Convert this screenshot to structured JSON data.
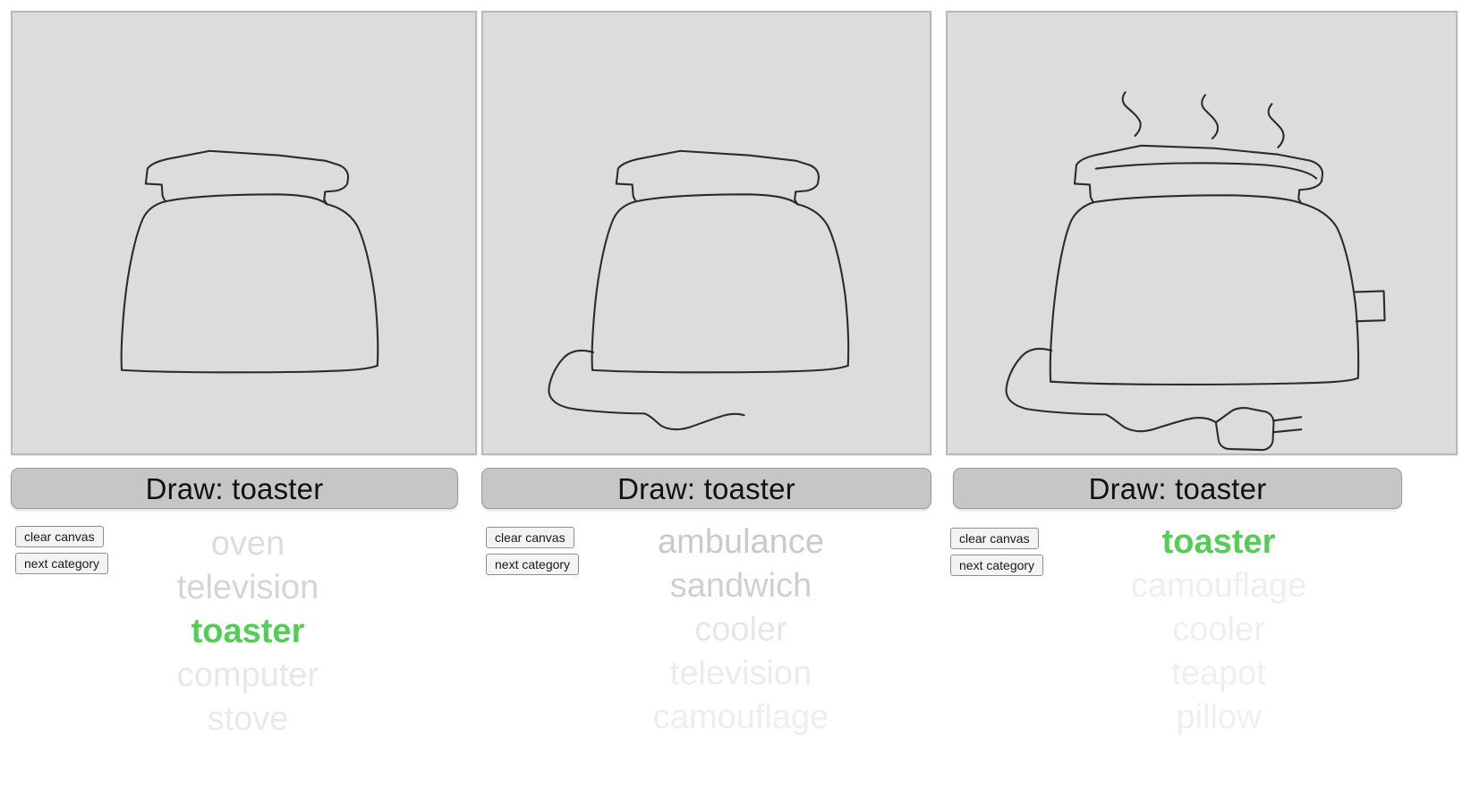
{
  "app": {
    "title": "Draw: toaster",
    "match_color": "#55cc55",
    "canvas_color": "#dcdcdc"
  },
  "panels": [
    {
      "id": "panel-1",
      "draw_bar_label": "Draw: toaster",
      "buttons": {
        "clear": "clear canvas",
        "next": "next category"
      },
      "drawing": "toaster-body-with-slot",
      "predictions": [
        {
          "label": "oven",
          "opacity": 0.45,
          "match": false
        },
        {
          "label": "television",
          "opacity": 0.55,
          "match": false
        },
        {
          "label": "toaster",
          "opacity": 1.0,
          "match": true
        },
        {
          "label": "computer",
          "opacity": 0.3,
          "match": false
        },
        {
          "label": "stove",
          "opacity": 0.28,
          "match": false
        }
      ]
    },
    {
      "id": "panel-2",
      "draw_bar_label": "Draw: toaster",
      "buttons": {
        "clear": "clear canvas",
        "next": "next category"
      },
      "drawing": "toaster-body-with-cord",
      "predictions": [
        {
          "label": "ambulance",
          "opacity": 0.7,
          "match": false
        },
        {
          "label": "sandwich",
          "opacity": 0.62,
          "match": false
        },
        {
          "label": "cooler",
          "opacity": 0.32,
          "match": false
        },
        {
          "label": "television",
          "opacity": 0.26,
          "match": false
        },
        {
          "label": "camouflage",
          "opacity": 0.22,
          "match": false
        }
      ]
    },
    {
      "id": "panel-3",
      "draw_bar_label": "Draw: toaster",
      "buttons": {
        "clear": "clear canvas",
        "next": "next category"
      },
      "drawing": "toaster-with-toast-steam-cord-plug",
      "predictions": [
        {
          "label": "toaster",
          "opacity": 1.0,
          "match": true
        },
        {
          "label": "camouflage",
          "opacity": 0.22,
          "match": false
        },
        {
          "label": "cooler",
          "opacity": 0.2,
          "match": false
        },
        {
          "label": "teapot",
          "opacity": 0.2,
          "match": false
        },
        {
          "label": "pillow",
          "opacity": 0.2,
          "match": false
        }
      ]
    }
  ]
}
